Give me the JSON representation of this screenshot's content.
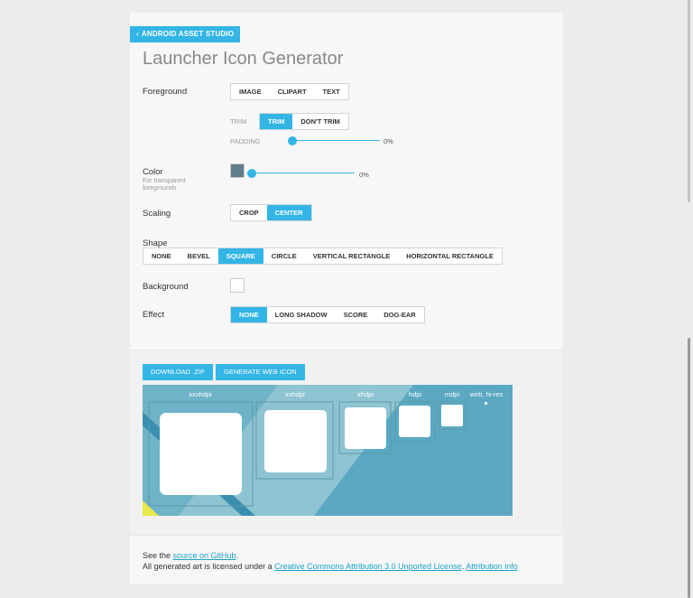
{
  "nav": {
    "back_label": "ANDROID ASSET STUDIO",
    "back_icon": "chevron-left-icon"
  },
  "page": {
    "title": "Launcher Icon Generator"
  },
  "foreground": {
    "label": "Foreground",
    "options": [
      "IMAGE",
      "CLIPART",
      "TEXT"
    ],
    "trim_label": "TRIM",
    "trim_options": [
      "TRIM",
      "DON'T TRIM"
    ],
    "trim_selected": "TRIM",
    "padding_label": "PADDING",
    "padding_value": "0%",
    "padding_fraction": 0.0
  },
  "color": {
    "label": "Color",
    "hint_line1": "For transparent",
    "hint_line2": "foregrounds",
    "swatch": "#607d8b",
    "value": "0%",
    "fraction": 0.0
  },
  "scaling": {
    "label": "Scaling",
    "options": [
      "CROP",
      "CENTER"
    ],
    "selected": "CENTER"
  },
  "shape": {
    "label": "Shape",
    "options": [
      "NONE",
      "BEVEL",
      "SQUARE",
      "CIRCLE",
      "VERTICAL RECTANGLE",
      "HORIZONTAL RECTANGLE"
    ],
    "selected": "SQUARE"
  },
  "background": {
    "label": "Background",
    "swatch": "#ffffff"
  },
  "effect": {
    "label": "Effect",
    "options": [
      "NONE",
      "LONG SHADOW",
      "SCORE",
      "DOG-EAR"
    ],
    "selected": "NONE"
  },
  "actions": {
    "download": "DOWNLOAD .ZIP",
    "generate_web": "GENERATE WEB ICON"
  },
  "preview": {
    "densities": [
      "xxxhdpi",
      "xxhdpi",
      "xhdpi",
      "hdpi",
      "mdpi",
      "web, hi-res"
    ],
    "colors": {
      "bg": "#6fb3c8",
      "band": "#3a8fb0",
      "accent": "#e8e84a",
      "panel": "#8ec4d2"
    }
  },
  "footer": {
    "line1_prefix": "See the ",
    "line1_link": "source on GitHub",
    "line1_suffix": ".",
    "line2_prefix": "All generated art is licensed under a ",
    "line2_link1": "Creative Commons Attribution 3.0 Unported License",
    "line2_mid": ". ",
    "line2_link2": "Attribution info"
  }
}
